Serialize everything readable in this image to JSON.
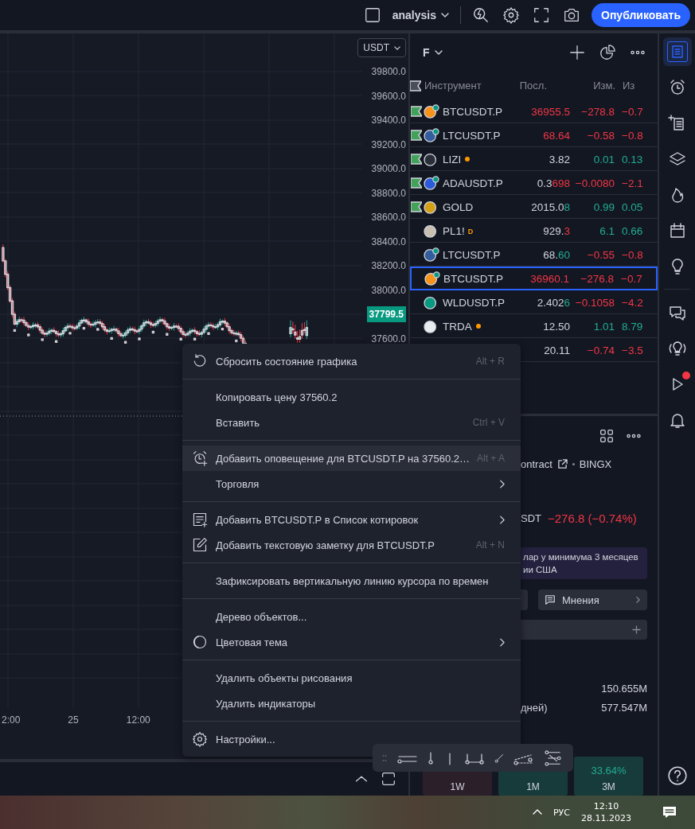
{
  "top_bar": {
    "layout_name": "analysis",
    "publish_button": "Опубликовать"
  },
  "chart": {
    "currency": "USDT",
    "price_labels": [
      {
        "text": "39800.0",
        "kind": "tick"
      },
      {
        "text": "39600.0",
        "kind": "tick"
      },
      {
        "text": "39400.0",
        "kind": "tick"
      },
      {
        "text": "39200.0",
        "kind": "tick"
      },
      {
        "text": "39000.0",
        "kind": "tick"
      },
      {
        "text": "38800.0",
        "kind": "tick"
      },
      {
        "text": "38600.0",
        "kind": "tick"
      },
      {
        "text": "38400.0",
        "kind": "tick"
      },
      {
        "text": "38200.0",
        "kind": "tick"
      },
      {
        "text": "38000.0",
        "kind": "tick"
      },
      {
        "text": "37799.5",
        "kind": "last"
      },
      {
        "text": "37600.0",
        "kind": "tick"
      }
    ],
    "time_labels": [
      "2:00",
      "25",
      "12:00"
    ]
  },
  "watchlist": {
    "list_name": "F",
    "columns": [
      "Инструмент",
      "Посл.",
      "Изм.",
      "Из"
    ],
    "rows": [
      {
        "symbol": "BTCUSDT.P",
        "flagged": true,
        "color": "#f7931a",
        "perp": true,
        "dot": false,
        "last_tail": "36955.5",
        "tail_down": true,
        "change": "−278.8",
        "percent": "−0.7",
        "down": true,
        "selected": false
      },
      {
        "symbol": "LTCUSDT.P",
        "flagged": true,
        "color": "#345d9d",
        "perp": true,
        "dot": false,
        "last_tail": "68.64",
        "tail_down": true,
        "change": "−0.58",
        "percent": "−0.8",
        "down": true,
        "selected": false
      },
      {
        "symbol": "LIZI",
        "flagged": true,
        "color": "#2a2e39",
        "perp": false,
        "dot": true,
        "last_head": "3.82",
        "change": "0.01",
        "percent": "0.13",
        "down": false,
        "selected": false
      },
      {
        "symbol": "ADAUSDT.P",
        "flagged": true,
        "color": "#2a5ada",
        "perp": true,
        "dot": false,
        "last_head": "0.3",
        "last_tail": "698",
        "tail_down": true,
        "change": "−0.0080",
        "percent": "−2.1",
        "down": true,
        "selected": false
      },
      {
        "symbol": "GOLD",
        "flagged": true,
        "color": "#d4a017",
        "perp": false,
        "dot": false,
        "last_head": "2015.0",
        "last_tail": "8",
        "tail_down": false,
        "change": "0.99",
        "percent": "0.05",
        "down": false,
        "selected": false
      },
      {
        "symbol": "PL1!",
        "badge": "D",
        "flagged": false,
        "color": "#c9bfb0",
        "perp": false,
        "dot": false,
        "last_head": "929.",
        "last_tail": "3",
        "tail_down": true,
        "change": "6.1",
        "percent": "0.66",
        "down": false,
        "selected": false
      },
      {
        "symbol": "LTCUSDT.P",
        "flagged": false,
        "color": "#345d9d",
        "perp": true,
        "dot": false,
        "last_head": "68.",
        "last_tail": "60",
        "tail_down": false,
        "change": "−0.55",
        "percent": "−0.8",
        "down": true,
        "selected": false
      },
      {
        "symbol": "BTCUSDT.P",
        "flagged": false,
        "color": "#f7931a",
        "perp": true,
        "dot": false,
        "last_tail": "36960.1",
        "tail_down": true,
        "change": "−276.8",
        "percent": "−0.7",
        "down": true,
        "selected": true
      },
      {
        "symbol": "WLDUSDT.P",
        "flagged": false,
        "color": "#089981",
        "perp": false,
        "dot": false,
        "last_head": "2.402",
        "last_tail": "6",
        "tail_down": false,
        "change": "−0.1058",
        "percent": "−4.2",
        "down": true,
        "selected": false
      },
      {
        "symbol": "TRDA",
        "flagged": false,
        "color": "#e8eef0",
        "perp": false,
        "dot": true,
        "last_head": "12.50",
        "change": "1.01",
        "percent": "8.79",
        "down": false,
        "selected": false
      },
      {
        "last_head": "20.11",
        "change": "−0.74",
        "percent": "−3.5",
        "down": true,
        "selected": false
      }
    ]
  },
  "details": {
    "exchange_fragment": "ontract",
    "exchange": "BINGX",
    "currency_fragment": "SDT",
    "change": "−276.8 (−0.74%)",
    "change_down": true,
    "banner_lines": [
      "лар у минимума 3 месяцев",
      "ии США"
    ],
    "opinions_button": "Мнения",
    "stats": [
      {
        "value": "150.655M"
      },
      {
        "label": "дней)",
        "value": "577.547M"
      }
    ],
    "performance": [
      {
        "label": "1W",
        "down": true
      },
      {
        "label": "1M",
        "down": false
      },
      {
        "label": "3M",
        "value": "33.64%",
        "down": false
      }
    ]
  },
  "context_menu": {
    "groups": [
      [
        {
          "label": "Сбросить состояние графика",
          "kind": "reset",
          "shortcut": "Alt + R",
          "submenu": false,
          "highlighted": false
        }
      ],
      [
        {
          "label": "Копировать цену 37560.2",
          "kind": "plain",
          "submenu": false,
          "highlighted": false
        },
        {
          "label": "Вставить",
          "kind": "plain",
          "shortcut": "Ctrl + V",
          "submenu": false,
          "highlighted": false
        }
      ],
      [
        {
          "label": "Добавить оповещение для BTCUSDT.P на 37560.2…",
          "kind": "alert",
          "shortcut": "Alt + A",
          "submenu": false,
          "highlighted": true
        },
        {
          "label": "Торговля",
          "kind": "plain",
          "submenu": true,
          "highlighted": false
        }
      ],
      [
        {
          "label": "Добавить BTCUSDT.P в Список котировок",
          "kind": "watchlist",
          "submenu": true,
          "highlighted": false
        },
        {
          "label": "Добавить текстовую заметку для BTCUSDT.P",
          "kind": "note",
          "shortcut": "Alt + N",
          "submenu": false,
          "highlighted": false
        }
      ],
      [
        {
          "label": "Зафиксировать вертикальную линию курсора по времен",
          "kind": "plain",
          "submenu": false,
          "highlighted": false
        }
      ],
      [
        {
          "label": "Дерево объектов...",
          "kind": "plain",
          "submenu": false,
          "highlighted": false
        },
        {
          "label": "Цветовая тема",
          "kind": "theme",
          "submenu": true,
          "highlighted": false
        }
      ],
      [
        {
          "label": "Удалить объекты рисования",
          "kind": "plain",
          "submenu": false,
          "highlighted": false
        },
        {
          "label": "Удалить индикаторы",
          "kind": "plain",
          "submenu": false,
          "highlighted": false
        }
      ],
      [
        {
          "label": "Настройки...",
          "kind": "settings",
          "submenu": false,
          "highlighted": false
        }
      ]
    ]
  },
  "right_toolbar": [
    {
      "selected": true,
      "alert_dot": false
    },
    {
      "selected": false,
      "alert_dot": false
    },
    {
      "selected": false,
      "alert_dot": false
    },
    {
      "selected": false,
      "alert_dot": false
    },
    {
      "selected": false,
      "alert_dot": false
    },
    {
      "selected": false,
      "alert_dot": false
    },
    {
      "selected": false,
      "alert_dot": false
    },
    {
      "selected": false,
      "alert_dot": false
    },
    {
      "selected": false,
      "alert_dot": false
    },
    {
      "selected": false,
      "alert_dot": true
    },
    {
      "selected": false,
      "alert_dot": false
    }
  ],
  "taskbar": {
    "language": "РУС",
    "time": "12:10",
    "date": "28.11.2023"
  }
}
